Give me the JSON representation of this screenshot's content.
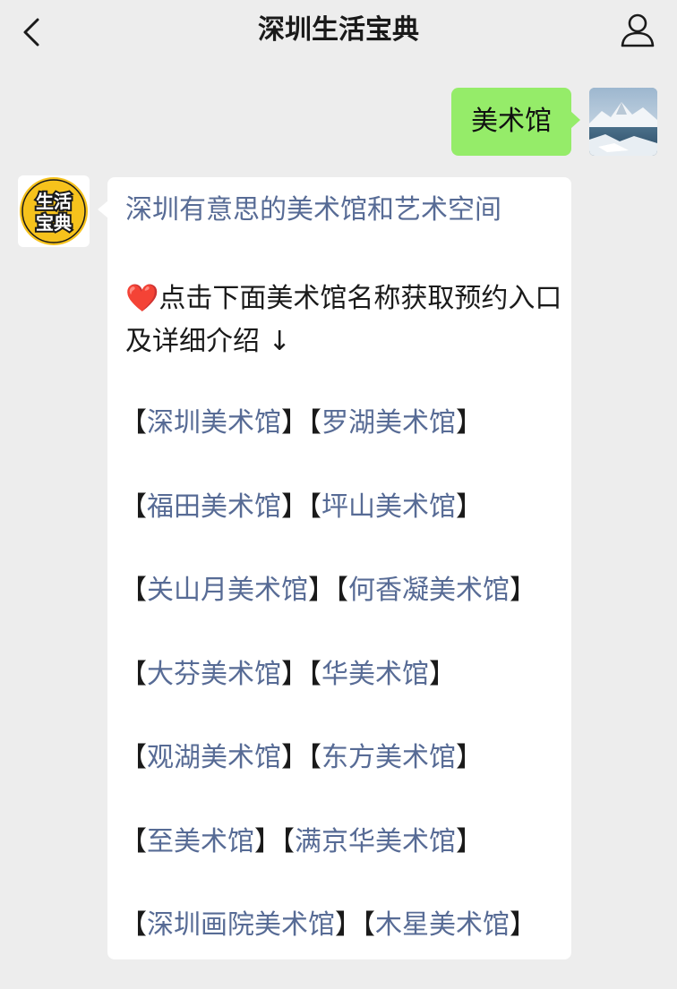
{
  "header": {
    "title": "深圳生活宝典"
  },
  "outgoing": {
    "text": "美术馆"
  },
  "bot": {
    "avatar_text": "生活宝典",
    "avatar_line1": "生活",
    "avatar_line2": "宝典"
  },
  "incoming": {
    "link_title": "深圳有意思的美术馆和艺术空间",
    "heart": "❤️",
    "intro": "点击下面美术馆名称获取预约入口及详细介绍 ↓",
    "rows": [
      [
        "深圳美术馆",
        "罗湖美术馆"
      ],
      [
        "福田美术馆",
        "坪山美术馆"
      ],
      [
        "关山月美术馆",
        "何香凝美术馆"
      ],
      [
        "大芬美术馆",
        "华美术馆"
      ],
      [
        "观湖美术馆",
        "东方美术馆"
      ],
      [
        "至美术馆",
        "满京华美术馆"
      ],
      [
        "深圳画院美术馆",
        "木星美术馆"
      ]
    ]
  },
  "colors": {
    "background": "#ededed",
    "outgoing_bubble": "#95ec69",
    "link": "#576b95",
    "avatar_yellow": "#f6c21c"
  },
  "icons": {
    "back": "chevron-left-icon",
    "profile": "person-icon"
  }
}
